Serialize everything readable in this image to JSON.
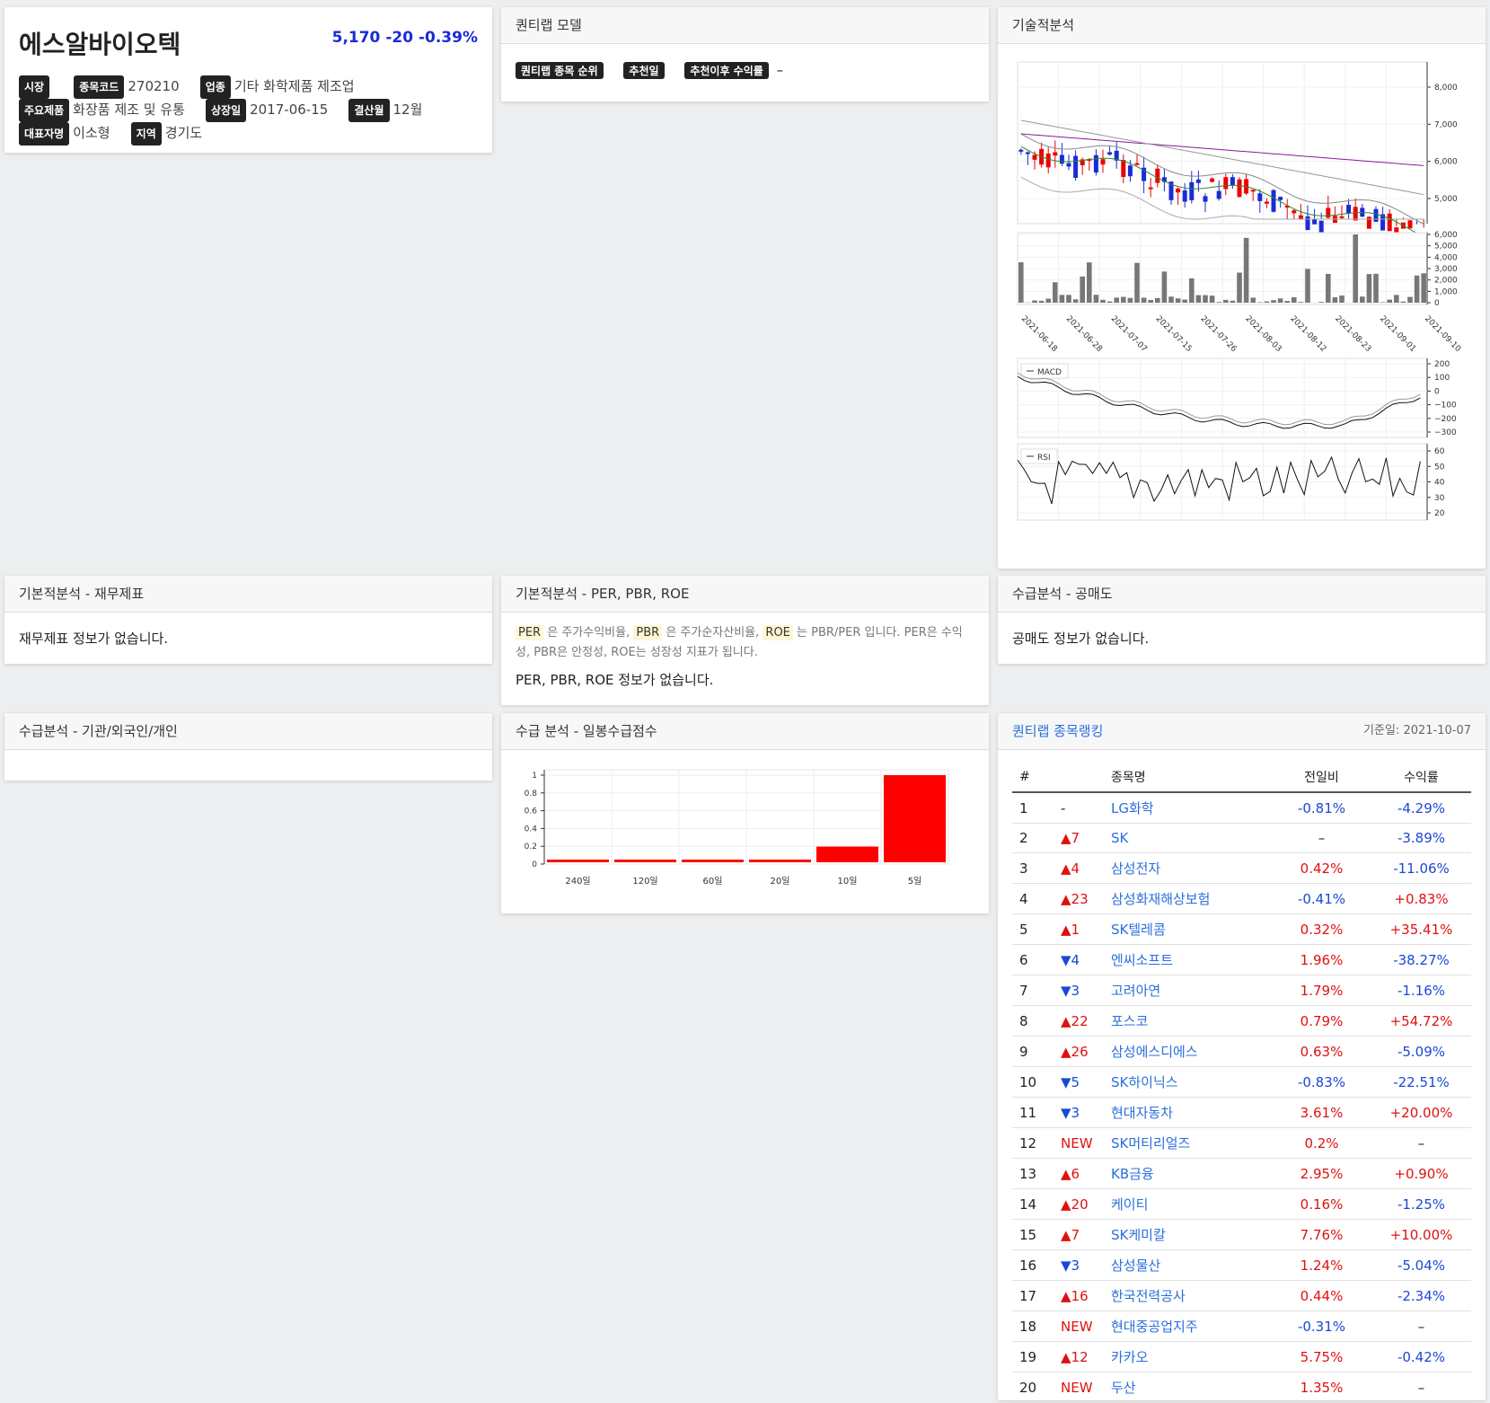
{
  "stock": {
    "name": "에스알바이오텍",
    "price": "5,170",
    "change": "-20",
    "change_pct": "-0.39%",
    "labels": {
      "market": "시장",
      "code": "종목코드",
      "industry": "업종",
      "product": "주요제품",
      "listing": "상장일",
      "fiscal": "결산월",
      "ceo": "대표자명",
      "region": "지역"
    },
    "code": "270210",
    "industry": "기타 화학제품 제조업",
    "product": "화장품 제조 및 유통",
    "listing": "2017-06-15",
    "fiscal": "12월",
    "ceo": "이소형",
    "region": "경기도"
  },
  "quant_model": {
    "title": "퀀티랩 모델",
    "tag_rank": "퀀티랩 종목 순위",
    "tag_date": "추천일",
    "tag_return": "추천이후 수익률",
    "return_value": "–"
  },
  "technical": {
    "title": "기술적분석",
    "price_ticks": [
      "8,000",
      "7,000",
      "6,000",
      "5,000"
    ],
    "volume_ticks": [
      "6,000",
      "5,000",
      "4,000",
      "3,000",
      "2,000",
      "1,000",
      "0"
    ],
    "dates": [
      "2021-06-18",
      "2021-06-28",
      "2021-07-07",
      "2021-07-15",
      "2021-07-26",
      "2021-08-03",
      "2021-08-12",
      "2021-08-23",
      "2021-09-01",
      "2021-09-10"
    ],
    "macd_label": "MACD",
    "macd_ticks": [
      "200",
      "100",
      "0",
      "−100",
      "−200",
      "−300"
    ],
    "rsi_label": "RSI",
    "rsi_ticks": [
      "60",
      "50",
      "40",
      "30",
      "20"
    ]
  },
  "financials": {
    "title": "기본적분석 - 재무제표",
    "empty": "재무제표 정보가 없습니다."
  },
  "ratios": {
    "title": "기본적분석 - PER, PBR, ROE",
    "per": "PER",
    "per_desc": "은 주가수익비율,",
    "pbr": "PBR",
    "pbr_desc": "은 주가순자산비율,",
    "roe": "ROE",
    "roe_desc": "는 PBR/PER 입니다. PER은 수익성, PBR은 안정성, ROE는 성장성 지표가 됩니다.",
    "empty": "PER, PBR, ROE 정보가 없습니다."
  },
  "short_sell": {
    "title": "수급분석 - 공매도",
    "empty": "공매도 정보가 없습니다."
  },
  "investors": {
    "title": "수급분석 - 기관/외국인/개인"
  },
  "supply_score": {
    "title": "수급 분석 - 일봉수급점수"
  },
  "chart_data": {
    "type": "bar",
    "categories": [
      "240일",
      "120일",
      "60일",
      "20일",
      "10일",
      "5일"
    ],
    "values": [
      0.03,
      0.03,
      0.03,
      0.03,
      0.18,
      1.0
    ],
    "ylim": [
      0,
      1
    ],
    "yticks": [
      "1",
      "0.8",
      "0.6",
      "0.4",
      "0.2",
      "0"
    ],
    "colors": {
      "bar": "#ff0000"
    }
  },
  "ranking": {
    "title": "퀀티랩 종목랭킹",
    "date": "기준일: 2021-10-07",
    "headers": {
      "no": "#",
      "name": "종목명",
      "day": "전일비",
      "ret": "수익률"
    },
    "rows": [
      {
        "no": "1",
        "chg": "-",
        "dir": "none",
        "name": "LG화학",
        "day": "-0.81%",
        "ret": "-4.29%"
      },
      {
        "no": "2",
        "chg": "▲7",
        "dir": "up",
        "name": "SK",
        "day": "–",
        "ret": "-3.89%"
      },
      {
        "no": "3",
        "chg": "▲4",
        "dir": "up",
        "name": "삼성전자",
        "day": "0.42%",
        "ret": "-11.06%"
      },
      {
        "no": "4",
        "chg": "▲23",
        "dir": "up",
        "name": "삼성화재해상보험",
        "day": "-0.41%",
        "ret": "+0.83%"
      },
      {
        "no": "5",
        "chg": "▲1",
        "dir": "up",
        "name": "SK텔레콤",
        "day": "0.32%",
        "ret": "+35.41%"
      },
      {
        "no": "6",
        "chg": "▼4",
        "dir": "down",
        "name": "엔씨소프트",
        "day": "1.96%",
        "ret": "-38.27%"
      },
      {
        "no": "7",
        "chg": "▼3",
        "dir": "down",
        "name": "고려아연",
        "day": "1.79%",
        "ret": "-1.16%"
      },
      {
        "no": "8",
        "chg": "▲22",
        "dir": "up",
        "name": "포스코",
        "day": "0.79%",
        "ret": "+54.72%"
      },
      {
        "no": "9",
        "chg": "▲26",
        "dir": "up",
        "name": "삼성에스디에스",
        "day": "0.63%",
        "ret": "-5.09%"
      },
      {
        "no": "10",
        "chg": "▼5",
        "dir": "down",
        "name": "SK하이닉스",
        "day": "-0.83%",
        "ret": "-22.51%"
      },
      {
        "no": "11",
        "chg": "▼3",
        "dir": "down",
        "name": "현대자동차",
        "day": "3.61%",
        "ret": "+20.00%"
      },
      {
        "no": "12",
        "chg": "NEW",
        "dir": "new",
        "name": "SK머티리얼즈",
        "day": "0.2%",
        "ret": "–"
      },
      {
        "no": "13",
        "chg": "▲6",
        "dir": "up",
        "name": "KB금융",
        "day": "2.95%",
        "ret": "+0.90%"
      },
      {
        "no": "14",
        "chg": "▲20",
        "dir": "up",
        "name": "케이티",
        "day": "0.16%",
        "ret": "-1.25%"
      },
      {
        "no": "15",
        "chg": "▲7",
        "dir": "up",
        "name": "SK케미칼",
        "day": "7.76%",
        "ret": "+10.00%"
      },
      {
        "no": "16",
        "chg": "▼3",
        "dir": "down",
        "name": "삼성물산",
        "day": "1.24%",
        "ret": "-5.04%"
      },
      {
        "no": "17",
        "chg": "▲16",
        "dir": "up",
        "name": "한국전력공사",
        "day": "0.44%",
        "ret": "-2.34%"
      },
      {
        "no": "18",
        "chg": "NEW",
        "dir": "new",
        "name": "현대중공업지주",
        "day": "-0.31%",
        "ret": "–"
      },
      {
        "no": "19",
        "chg": "▲12",
        "dir": "up",
        "name": "카카오",
        "day": "5.75%",
        "ret": "-0.42%"
      },
      {
        "no": "20",
        "chg": "NEW",
        "dir": "new",
        "name": "두산",
        "day": "1.35%",
        "ret": "–"
      }
    ]
  }
}
